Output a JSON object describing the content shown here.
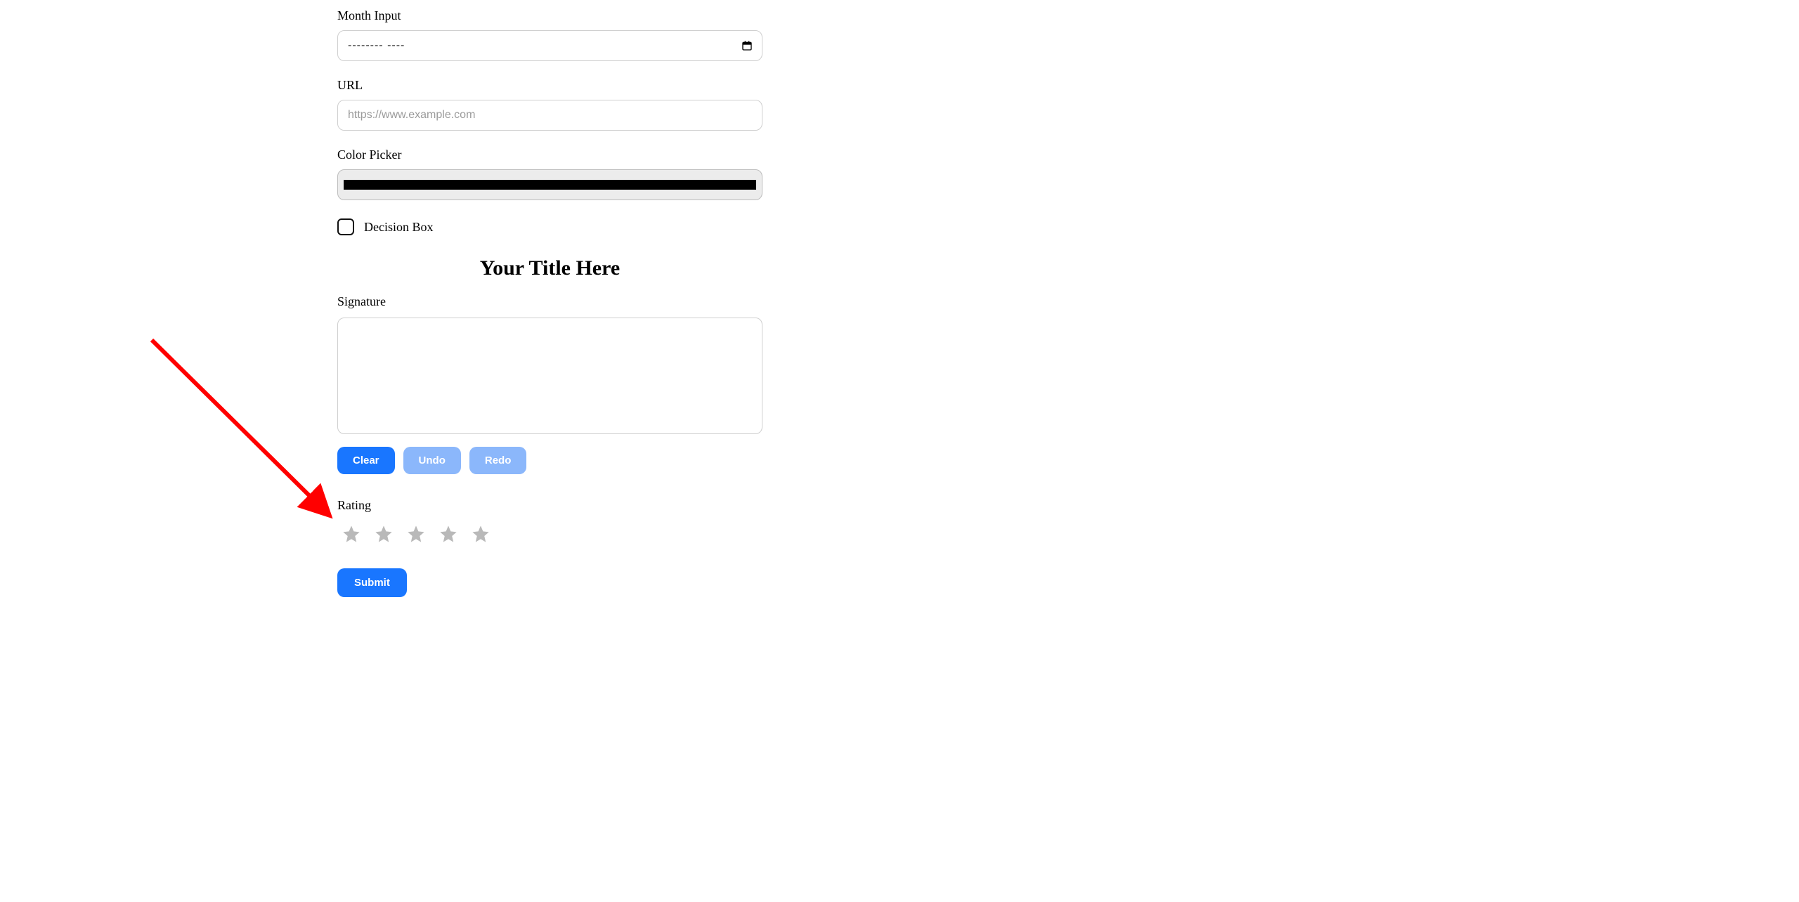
{
  "fields": {
    "month_label": "Month Input",
    "month_value": "--------  ----",
    "url_label": "URL",
    "url_placeholder": "https://www.example.com",
    "color_label": "Color Picker",
    "color_value": "#000000",
    "decision_label": "Decision Box",
    "decision_checked": false
  },
  "title": "Your Title Here",
  "signature": {
    "label": "Signature",
    "buttons": {
      "clear": "Clear",
      "undo": "Undo",
      "redo": "Redo"
    }
  },
  "rating": {
    "label": "Rating",
    "value": 0,
    "max": 5
  },
  "submit_label": "Submit",
  "icons": {
    "calendar": "calendar-icon",
    "star": "star-icon"
  },
  "colors": {
    "primary": "#1976ff",
    "disabled": "#8bb7fb",
    "star_inactive": "#b9b9b9",
    "annotation_arrow": "#ff0000"
  }
}
